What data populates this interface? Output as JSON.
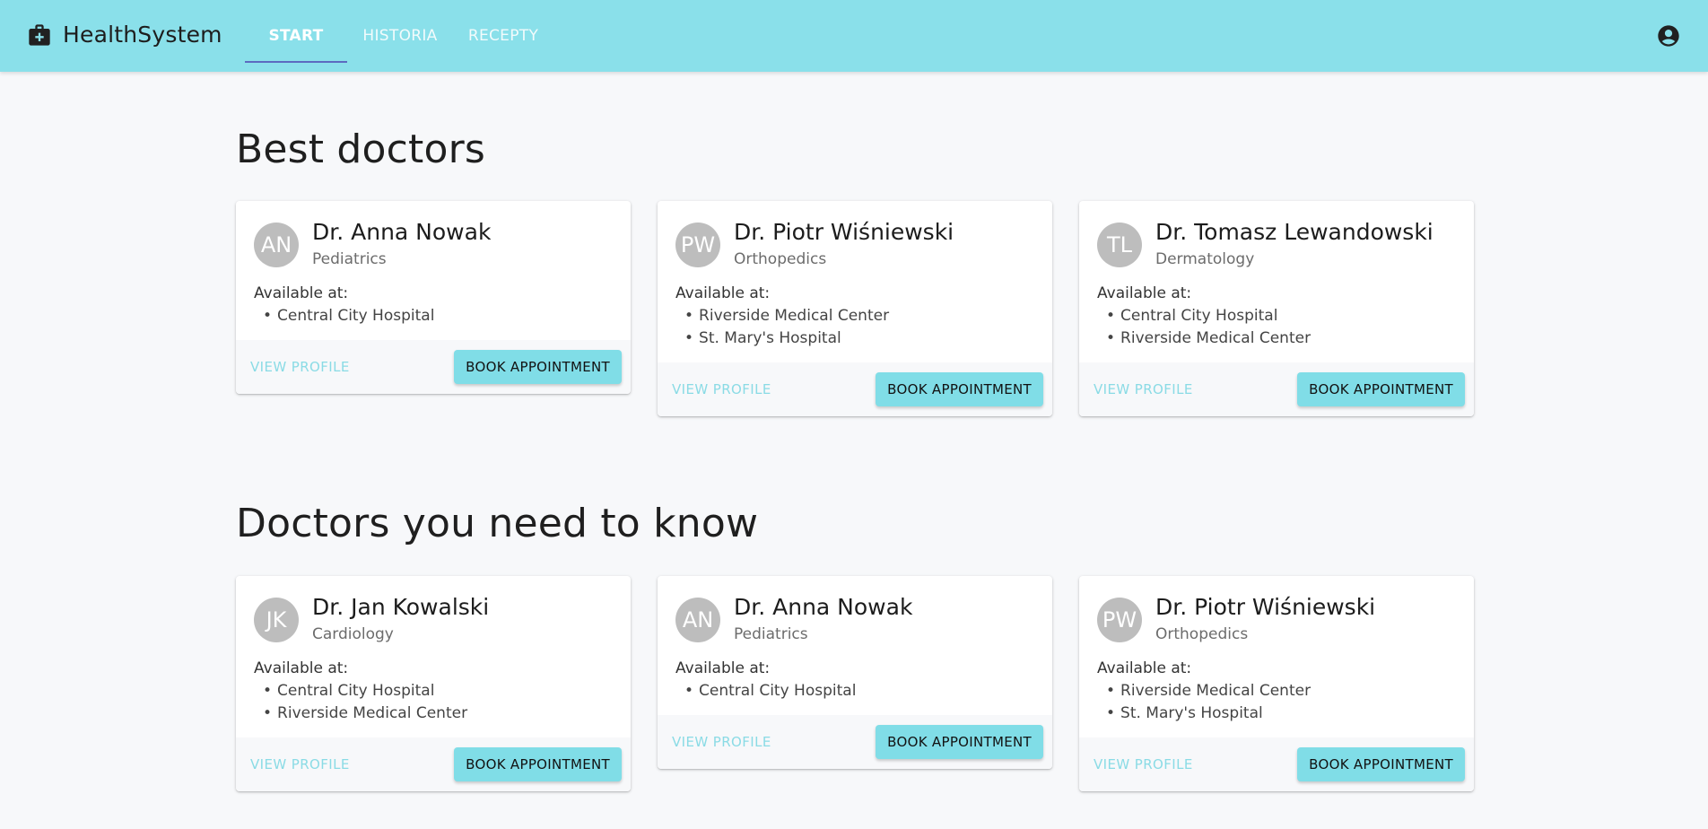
{
  "app": {
    "title": "HealthSystem",
    "brand_icon": "medical-briefcase-icon",
    "account_icon": "account-circle-icon",
    "colors": {
      "appbar": "#8ae0ea",
      "accent_button": "#80dde7",
      "tab_indicator": "#5c6bc0",
      "text_button": "#8adbe5"
    }
  },
  "nav": {
    "tabs": [
      {
        "label": "START",
        "active": true
      },
      {
        "label": "HISTORIA",
        "active": false
      },
      {
        "label": "RECEPTY",
        "active": false
      }
    ]
  },
  "sections": [
    {
      "title": "Best doctors",
      "doctors": [
        {
          "initials": "AN",
          "name": "Dr. Anna Nowak",
          "specialty": "Pediatrics",
          "available_label": "Available at:",
          "locations": [
            "Central City Hospital"
          ],
          "view_label": "VIEW PROFILE",
          "book_label": "BOOK APPOINTMENT"
        },
        {
          "initials": "PW",
          "name": "Dr. Piotr Wiśniewski",
          "specialty": "Orthopedics",
          "available_label": "Available at:",
          "locations": [
            "Riverside Medical Center",
            "St. Mary's Hospital"
          ],
          "view_label": "VIEW PROFILE",
          "book_label": "BOOK APPOINTMENT"
        },
        {
          "initials": "TL",
          "name": "Dr. Tomasz Lewandowski",
          "specialty": "Dermatology",
          "available_label": "Available at:",
          "locations": [
            "Central City Hospital",
            "Riverside Medical Center"
          ],
          "view_label": "VIEW PROFILE",
          "book_label": "BOOK APPOINTMENT"
        }
      ]
    },
    {
      "title": "Doctors you need to know",
      "doctors": [
        {
          "initials": "JK",
          "name": "Dr. Jan Kowalski",
          "specialty": "Cardiology",
          "available_label": "Available at:",
          "locations": [
            "Central City Hospital",
            "Riverside Medical Center"
          ],
          "view_label": "VIEW PROFILE",
          "book_label": "BOOK APPOINTMENT"
        },
        {
          "initials": "AN",
          "name": "Dr. Anna Nowak",
          "specialty": "Pediatrics",
          "available_label": "Available at:",
          "locations": [
            "Central City Hospital"
          ],
          "view_label": "VIEW PROFILE",
          "book_label": "BOOK APPOINTMENT"
        },
        {
          "initials": "PW",
          "name": "Dr. Piotr Wiśniewski",
          "specialty": "Orthopedics",
          "available_label": "Available at:",
          "locations": [
            "Riverside Medical Center",
            "St. Mary's Hospital"
          ],
          "view_label": "VIEW PROFILE",
          "book_label": "BOOK APPOINTMENT"
        }
      ]
    }
  ]
}
